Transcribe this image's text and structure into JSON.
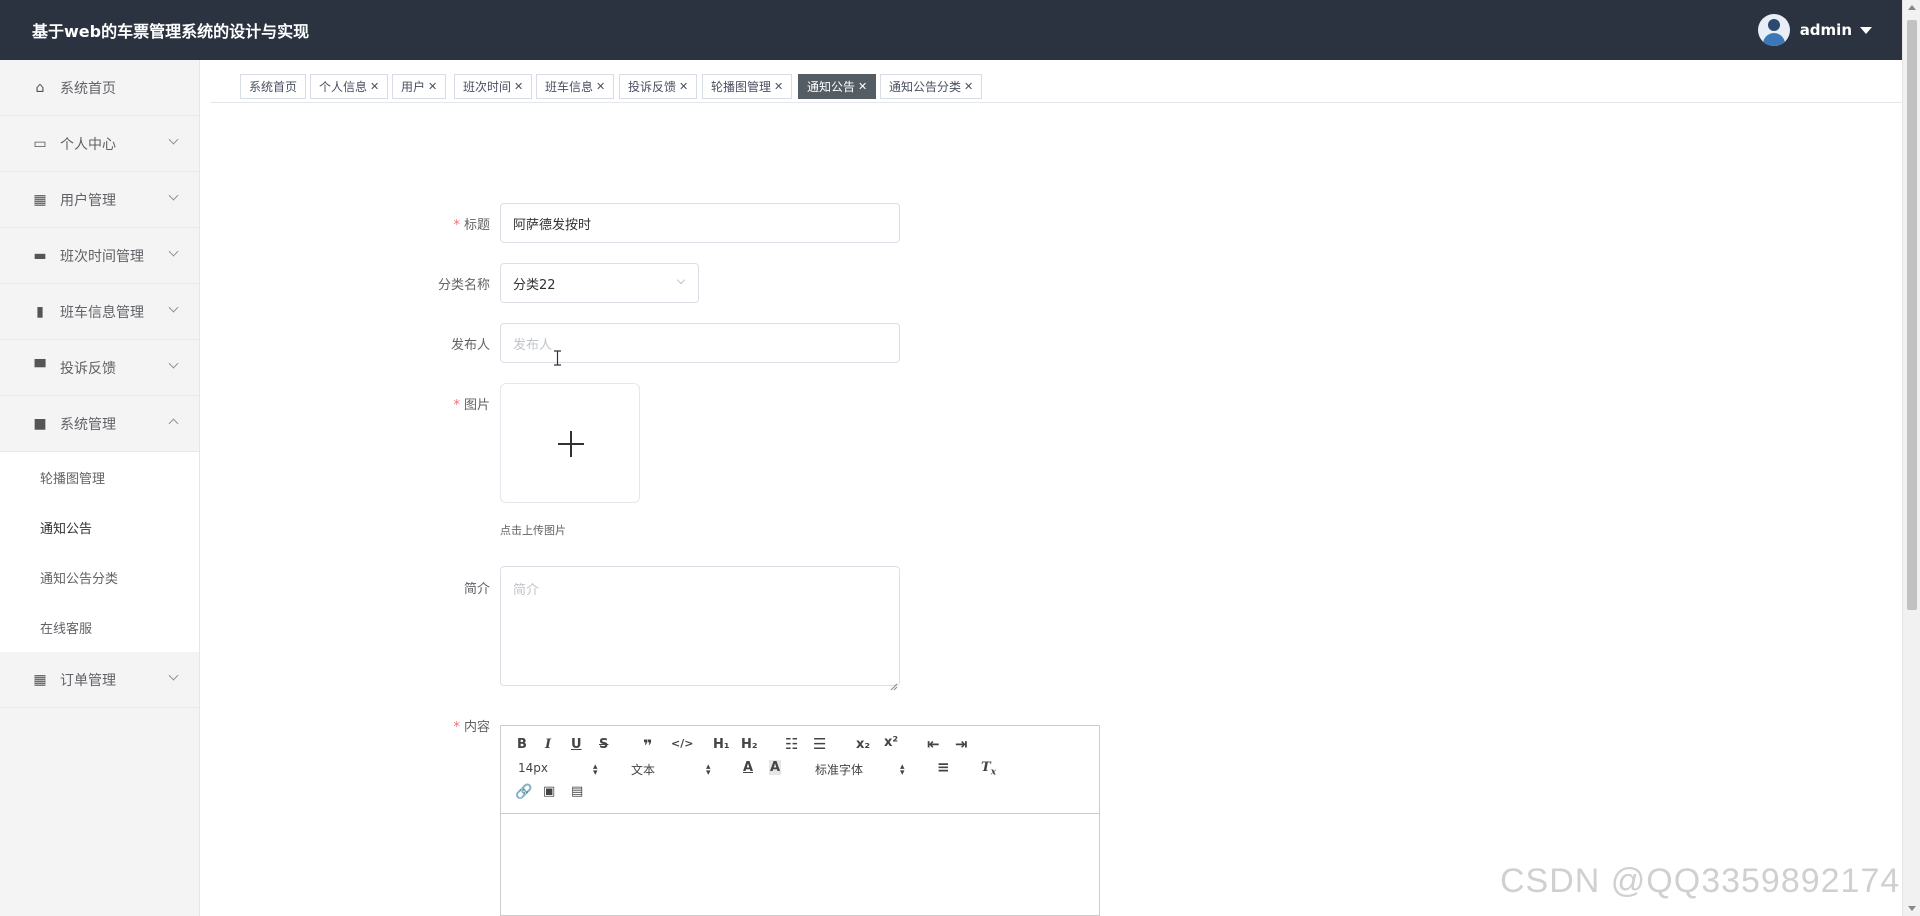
{
  "header": {
    "title": "基于web的车票管理系统的设计与实现",
    "user": "admin"
  },
  "sidebar": {
    "items": [
      {
        "label": "系统首页",
        "icon": "home-icon"
      },
      {
        "label": "个人中心",
        "icon": "id-card-icon"
      },
      {
        "label": "用户管理",
        "icon": "grid-icon"
      },
      {
        "label": "班次时间管理",
        "icon": "briefcase-icon"
      },
      {
        "label": "班车信息管理",
        "icon": "clipboard-icon"
      },
      {
        "label": "投诉反馈",
        "icon": "monitor-icon"
      },
      {
        "label": "系统管理",
        "icon": "chat-icon"
      },
      {
        "label": "订单管理",
        "icon": "grid-icon"
      }
    ],
    "submenu": [
      "轮播图管理",
      "通知公告",
      "通知公告分类",
      "在线客服"
    ]
  },
  "tabs": [
    {
      "label": "系统首页"
    },
    {
      "label": "个人信息"
    },
    {
      "label": "用户"
    },
    {
      "label": "班次时间"
    },
    {
      "label": "班车信息"
    },
    {
      "label": "投诉反馈"
    },
    {
      "label": "轮播图管理"
    },
    {
      "label": "通知公告"
    },
    {
      "label": "通知公告分类"
    }
  ],
  "form": {
    "title": {
      "label": "标题",
      "value": "阿萨德发按时"
    },
    "category": {
      "label": "分类名称",
      "value": "分类22"
    },
    "publisher": {
      "label": "发布人",
      "placeholder": "发布人"
    },
    "image": {
      "label": "图片",
      "hint": "点击上传图片"
    },
    "intro": {
      "label": "简介",
      "placeholder": "简介"
    },
    "content": {
      "label": "内容"
    }
  },
  "editor": {
    "font_size": "14px",
    "text_style": "文本",
    "font_family": "标准字体"
  },
  "watermark": "CSDN @QQ3359892174"
}
